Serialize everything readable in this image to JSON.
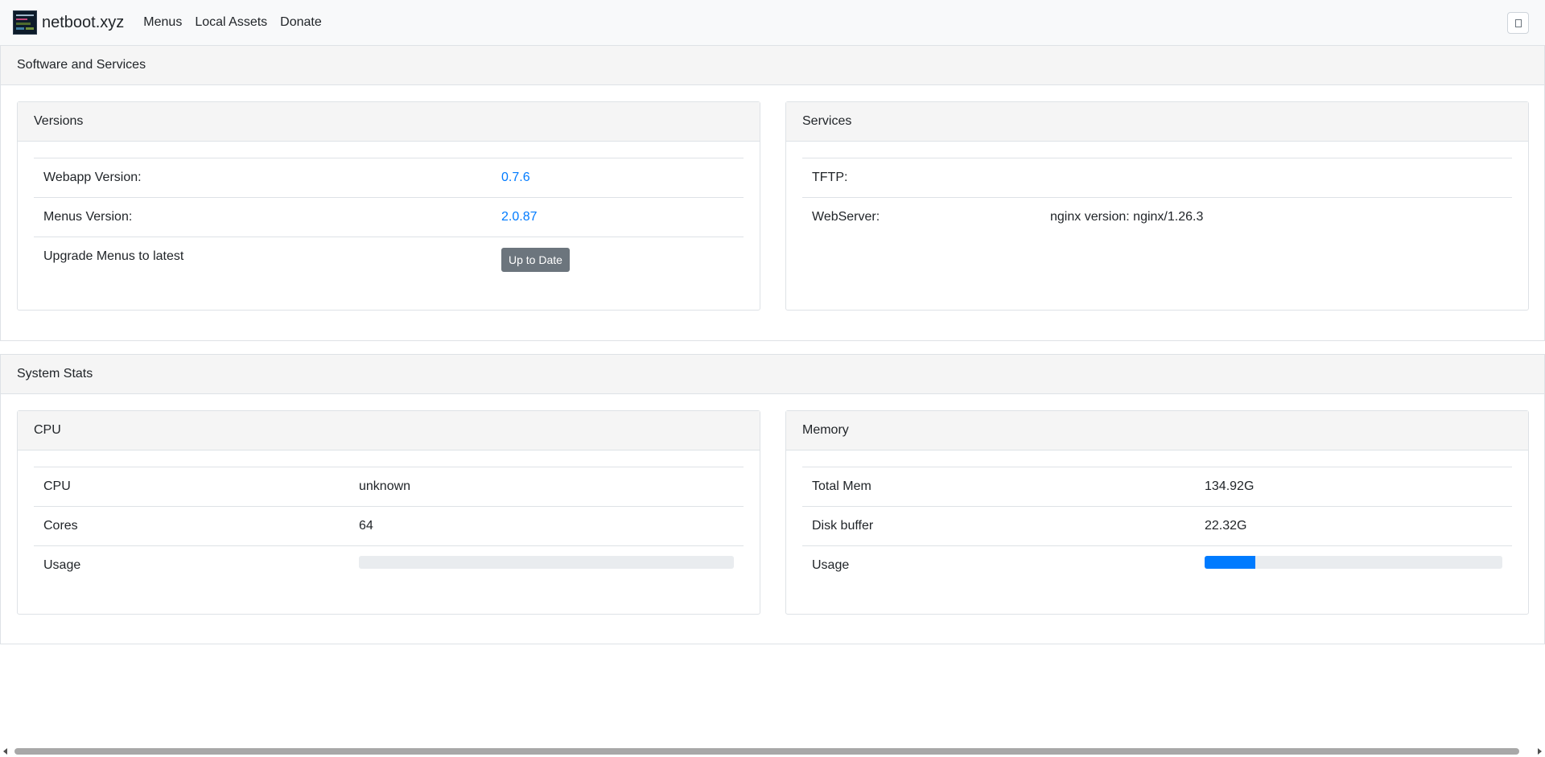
{
  "navbar": {
    "brand": "netboot.xyz",
    "links": [
      "Menus",
      "Local Assets",
      "Donate"
    ]
  },
  "software": {
    "title": "Software and Services",
    "versions": {
      "title": "Versions",
      "webapp_label": "Webapp Version:",
      "webapp_value": "0.7.6",
      "menus_label": "Menus Version:",
      "menus_value": "2.0.87",
      "upgrade_label": "Upgrade Menus to latest",
      "upgrade_button": "Up to Date"
    },
    "services": {
      "title": "Services",
      "tftp_label": "TFTP:",
      "tftp_value": "",
      "web_label": "WebServer:",
      "web_value": "nginx version: nginx/1.26.3"
    }
  },
  "system": {
    "title": "System Stats",
    "cpu": {
      "title": "CPU",
      "cpu_label": "CPU",
      "cpu_value": "unknown",
      "cores_label": "Cores",
      "cores_value": "64",
      "usage_label": "Usage",
      "usage_fraction": 0
    },
    "memory": {
      "title": "Memory",
      "total_label": "Total Mem",
      "total_value": "134.92G",
      "buffer_label": "Disk buffer",
      "buffer_value": "22.32G",
      "usage_label": "Usage",
      "usage_fraction": 0.17
    }
  },
  "colors": {
    "accent": "#007bff",
    "button": "#6c757d"
  }
}
